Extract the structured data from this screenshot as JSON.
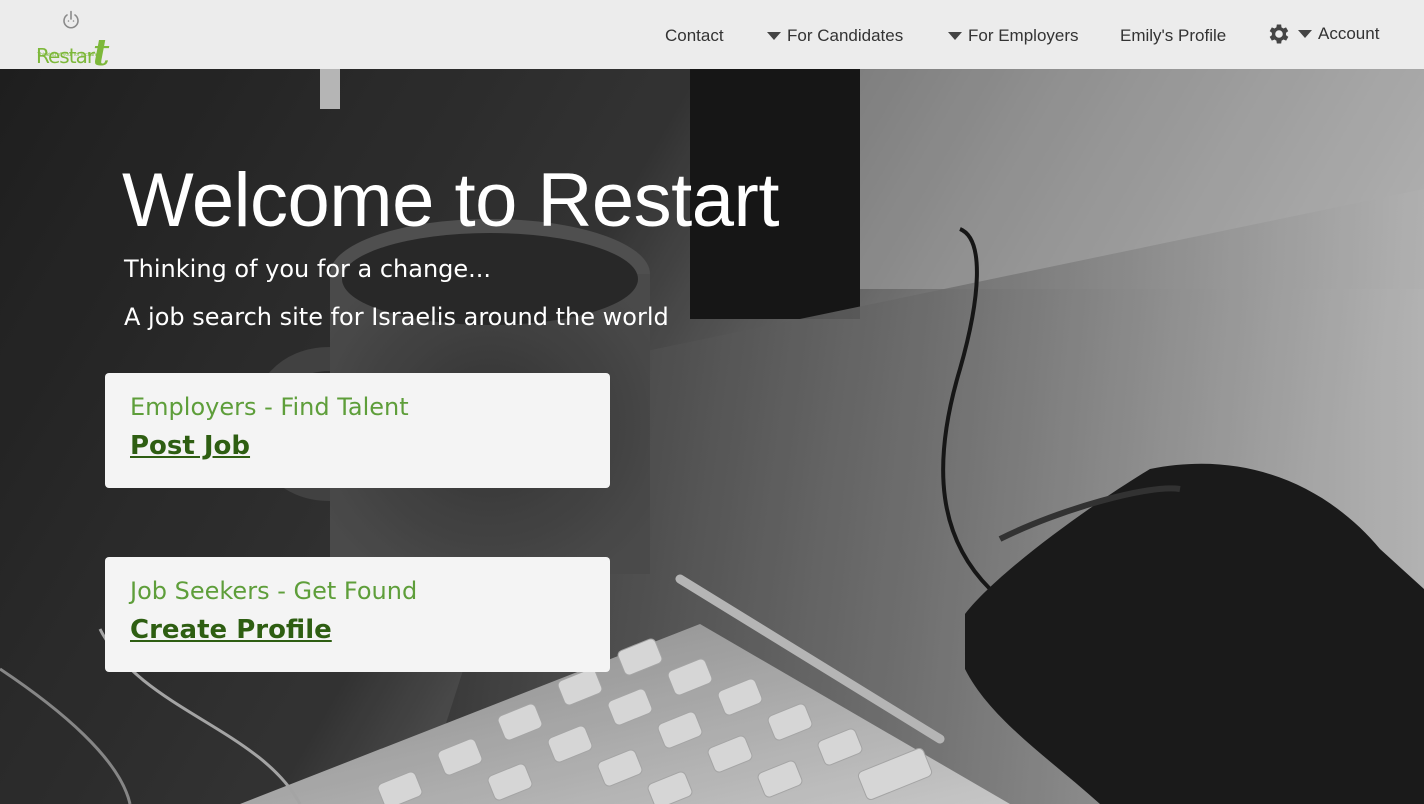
{
  "logo": {
    "text_main": "Restar",
    "text_t": "t",
    "tagline": "Thinking of you, for a change",
    "brand_color": "#7db83a"
  },
  "nav": {
    "contact": "Contact",
    "for_candidates": "For Candidates",
    "for_employers": "For Employers",
    "profile": "Emily's Profile",
    "account": "Account"
  },
  "hero": {
    "title": "Welcome to Restart",
    "subtitle1": "Thinking of you for a change...",
    "subtitle2": "A job search site for Israelis around the world"
  },
  "cards": {
    "employers": {
      "heading": "Employers - Find Talent",
      "link": "Post Job"
    },
    "seekers": {
      "heading": "Job Seekers - Get Found",
      "link": "Create Profile"
    }
  },
  "icons": {
    "logo_power": "power-icon",
    "settings": "gear-icon",
    "dropdown": "caret-down-icon"
  },
  "colors": {
    "navbar_bg": "#ececec",
    "card_bg": "#f4f4f4",
    "card_heading": "#5e9e3a",
    "card_link": "#2e5e12"
  }
}
